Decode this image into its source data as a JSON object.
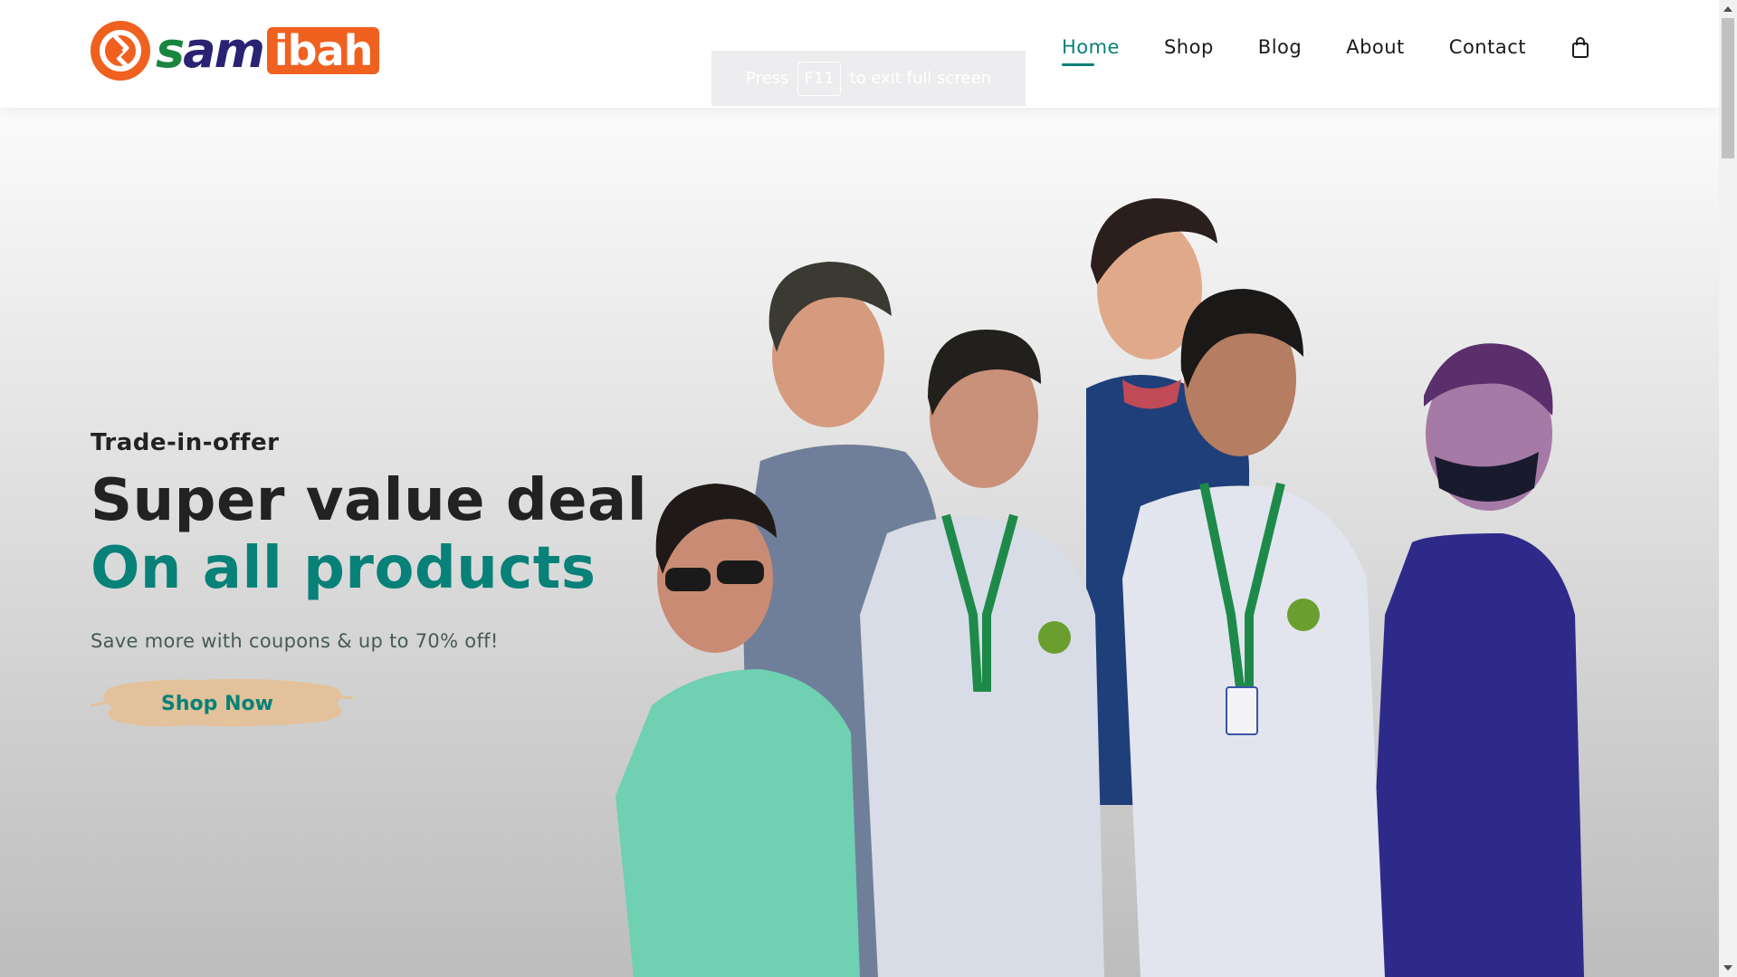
{
  "brand": {
    "logo_text_parts": [
      "s",
      "am",
      "ibah"
    ],
    "logo_full": "samibah",
    "colors": {
      "orange": "#f0601f",
      "green": "#19853f",
      "navy": "#2a2273",
      "accent": "#088178"
    }
  },
  "nav": {
    "items": [
      {
        "label": "Home",
        "active": true
      },
      {
        "label": "Shop",
        "active": false
      },
      {
        "label": "Blog",
        "active": false
      },
      {
        "label": "About",
        "active": false
      },
      {
        "label": "Contact",
        "active": false
      }
    ],
    "cart_icon": "shopping-bag-icon"
  },
  "fullscreen_toast": {
    "prefix": "Press",
    "key": "F11",
    "suffix": "to exit full screen"
  },
  "hero": {
    "kicker": "Trade-in-offer",
    "title": "Super value deal",
    "title_accent": "On all products",
    "subtitle": "Save more with coupons & up to 70% off!",
    "cta_label": "Shop Now",
    "image_description_icon": "group-photo-image"
  },
  "scrollbar": {
    "thumb_position": 0
  }
}
